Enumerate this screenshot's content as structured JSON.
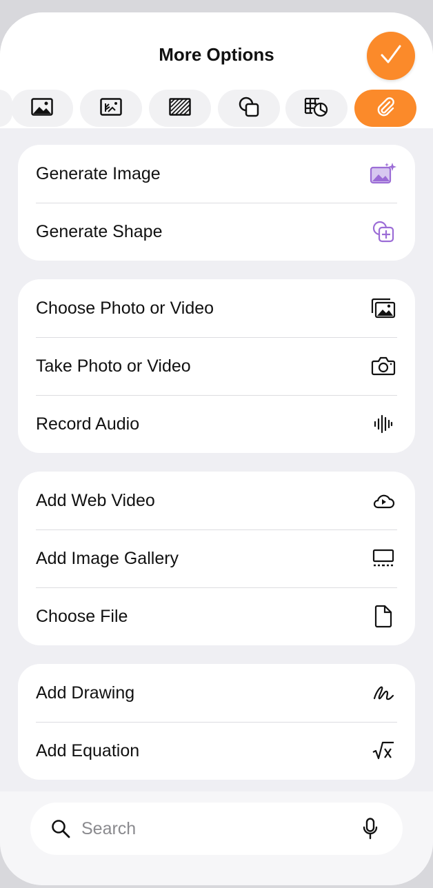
{
  "header": {
    "title": "More Options",
    "done_icon": "checkmark-icon"
  },
  "tabs": [
    {
      "icon": "cut-off-tab-icon",
      "active": false
    },
    {
      "icon": "image-icon",
      "active": false
    },
    {
      "icon": "image-adjust-icon",
      "active": false
    },
    {
      "icon": "texture-icon",
      "active": false
    },
    {
      "icon": "shape-icon",
      "active": false
    },
    {
      "icon": "table-chart-icon",
      "active": false
    },
    {
      "icon": "paperclip-icon",
      "active": true
    }
  ],
  "groups": [
    {
      "items": [
        {
          "label": "Generate Image",
          "icon": "generate-image-icon"
        },
        {
          "label": "Generate Shape",
          "icon": "generate-shape-icon"
        }
      ]
    },
    {
      "items": [
        {
          "label": "Choose Photo or Video",
          "icon": "photo-library-icon"
        },
        {
          "label": "Take Photo or Video",
          "icon": "camera-icon"
        },
        {
          "label": "Record Audio",
          "icon": "waveform-icon"
        }
      ]
    },
    {
      "items": [
        {
          "label": "Add Web Video",
          "icon": "cloud-play-icon"
        },
        {
          "label": "Add Image Gallery",
          "icon": "gallery-icon"
        },
        {
          "label": "Choose File",
          "icon": "document-icon"
        }
      ]
    },
    {
      "items": [
        {
          "label": "Add Drawing",
          "icon": "drawing-icon"
        },
        {
          "label": "Add Equation",
          "icon": "equation-icon"
        }
      ]
    }
  ],
  "search": {
    "placeholder": "Search",
    "value": ""
  },
  "colors": {
    "accent": "#fb8a2a",
    "ai_purple": "#9b6cd6"
  }
}
